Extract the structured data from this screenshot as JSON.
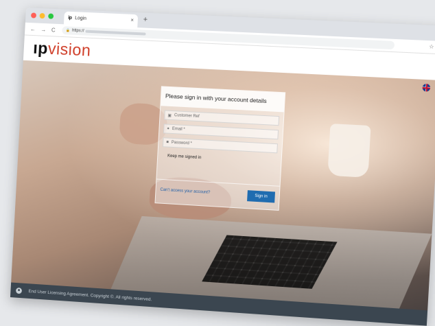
{
  "browser": {
    "tab_title": "Login",
    "tab_logo": "ip",
    "tab_close": "×",
    "new_tab": "+",
    "url_prefix": "https://",
    "nav_back": "←",
    "nav_forward": "→",
    "nav_reload": "C",
    "lock": "🔒",
    "star": "☆"
  },
  "site": {
    "brand_ip": "ıp",
    "brand_vision": "vision"
  },
  "login": {
    "heading": "Please sign in with your account details",
    "customer_ref_placeholder": "Customer Ref",
    "email_placeholder": "Email *",
    "password_placeholder": "Password *",
    "keep_signed_in": "Keep me signed in",
    "cant_access": "Can't access your account?",
    "sign_in": "Sign in"
  },
  "footer": {
    "text": "End User Licensing Agreement. Copyright ©. All rights reserved."
  },
  "colors": {
    "brand_red": "#d0402b",
    "footer_bg": "#3b4650",
    "button_blue": "#1f6cb0"
  }
}
